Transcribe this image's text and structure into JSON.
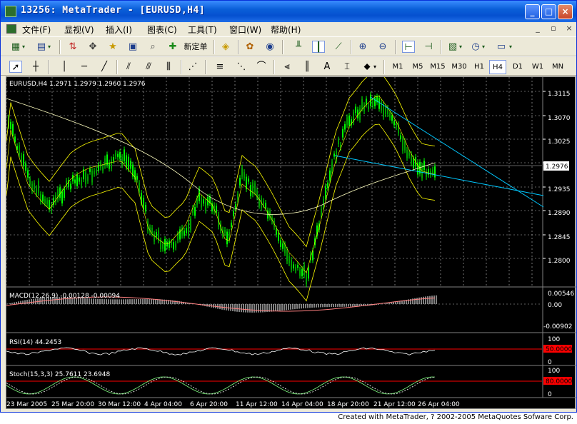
{
  "window": {
    "title": "13256: MetaTrader - [EURUSD,H4]",
    "minimize": "_",
    "maximize": "□",
    "close": "×"
  },
  "menu": {
    "items": [
      "文件(F)",
      "显视(V)",
      "插入(I)",
      "图表(C)",
      "工具(T)",
      "窗口(W)",
      "帮助(H)"
    ],
    "mdi_buttons": [
      "_",
      "▫",
      "×"
    ]
  },
  "toolbar1": {
    "new_order_label": "新定单"
  },
  "toolbar2": {
    "text_tool": "A",
    "timeframes": [
      "M1",
      "M5",
      "M15",
      "M30",
      "H1",
      "H4",
      "D1",
      "W1",
      "MN"
    ],
    "active_timeframe": "H4"
  },
  "chart": {
    "header": "EURUSD,H4  1.2971 1.2979 1.2960 1.2976",
    "current_price": "1.2976",
    "price_ticks": [
      "1.3115",
      "1.3070",
      "1.3025",
      "1.2980",
      "1.2935",
      "1.2890",
      "1.2845",
      "1.2800"
    ],
    "date_ticks": [
      "23 Mar 2005",
      "25 Mar 20:00",
      "30 Mar 12:00",
      "4 Apr 04:00",
      "6 Apr 20:00",
      "11 Apr 12:00",
      "14 Apr 04:00",
      "18 Apr 20:00",
      "21 Apr 12:00",
      "26 Apr 04:00"
    ],
    "colors": {
      "background": "#000000",
      "bull": "#00ff00",
      "bear": "#00a000",
      "bands": "#ffff00",
      "ma": "#ffffc0",
      "trendline": "#00c8ff",
      "macd_signal": "#ff8080",
      "level_line": "#ff0000",
      "grid": "#c0c0c0"
    }
  },
  "macd": {
    "header": "MACD(12,26,9) -0.00128 -0.00094",
    "ticks": [
      "0.00546",
      "0.00",
      "-0.00902"
    ]
  },
  "rsi": {
    "header": "RSI(14) 44.2453",
    "ticks": [
      "100",
      "0"
    ],
    "level": "50.0000"
  },
  "stoch": {
    "header": "Stoch(15,3,3) 25.7611 23.6948",
    "ticks": [
      "100",
      "0"
    ],
    "level": "80.0000"
  },
  "footer": "Created with MetaTrader, ? 2002-2005 MetaQuotes Sofware Corp."
}
